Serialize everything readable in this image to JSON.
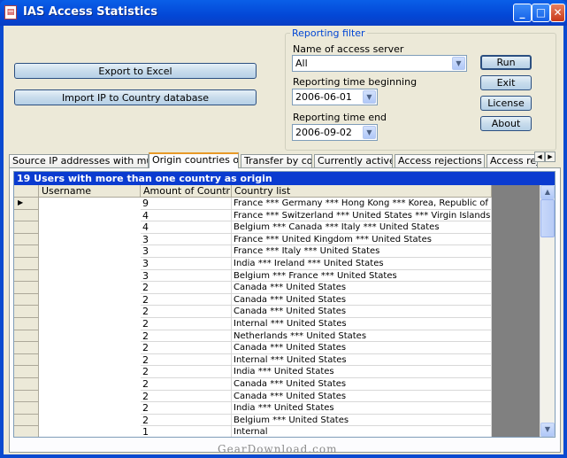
{
  "window": {
    "title": "IAS Access Statistics",
    "app_icon": "ias-app-icon",
    "buttons": {
      "minimize": "_",
      "maximize": "□",
      "close": "✕"
    }
  },
  "actions": {
    "export_excel": "Export to Excel",
    "import_ip": "Import IP to Country database",
    "run": "Run",
    "exit": "Exit",
    "license": "License",
    "about": "About"
  },
  "filter": {
    "title": "Reporting filter",
    "server_label": "Name of access server",
    "server_value": "All",
    "begin_label": "Reporting time beginning",
    "begin_value": "2006-06-01",
    "end_label": "Reporting time end",
    "end_value": "2006-09-02"
  },
  "tabs": [
    {
      "label": "Source IP addresses with multiple users"
    },
    {
      "label": "Origin countries of users"
    },
    {
      "label": "Transfer by country"
    },
    {
      "label": "Currently active users"
    },
    {
      "label": "Access rejections by day"
    },
    {
      "label": "Access reject"
    }
  ],
  "active_tab": 1,
  "grid": {
    "caption": "19 Users with more than one country as origin",
    "columns": [
      "Username",
      "Amount of Countries",
      "Country list"
    ],
    "sort_icon": "sort-descending-icon",
    "current_row_marker": "▶",
    "rows": [
      {
        "count": "9",
        "countries": "France *** Germany *** Hong Kong *** Korea, Republic of *** Macau ***"
      },
      {
        "count": "4",
        "countries": "France *** Switzerland *** United States *** Virgin Islands, U.S."
      },
      {
        "count": "4",
        "countries": "Belgium *** Canada *** Italy *** United States"
      },
      {
        "count": "3",
        "countries": "France *** United Kingdom *** United States"
      },
      {
        "count": "3",
        "countries": "France *** Italy *** United States"
      },
      {
        "count": "3",
        "countries": "India *** Ireland *** United States"
      },
      {
        "count": "3",
        "countries": "Belgium *** France *** United States"
      },
      {
        "count": "2",
        "countries": "Canada *** United States"
      },
      {
        "count": "2",
        "countries": "Canada *** United States"
      },
      {
        "count": "2",
        "countries": "Canada *** United States"
      },
      {
        "count": "2",
        "countries": "Internal *** United States"
      },
      {
        "count": "2",
        "countries": "Netherlands *** United States"
      },
      {
        "count": "2",
        "countries": "Canada *** United States"
      },
      {
        "count": "2",
        "countries": "Internal *** United States"
      },
      {
        "count": "2",
        "countries": "India *** United States"
      },
      {
        "count": "2",
        "countries": "Canada *** United States"
      },
      {
        "count": "2",
        "countries": "Canada *** United States"
      },
      {
        "count": "2",
        "countries": "India *** United States"
      },
      {
        "count": "2",
        "countries": "Belgium *** United States"
      },
      {
        "count": "1",
        "countries": "Internal"
      }
    ]
  },
  "watermark": "GearDownload.com"
}
